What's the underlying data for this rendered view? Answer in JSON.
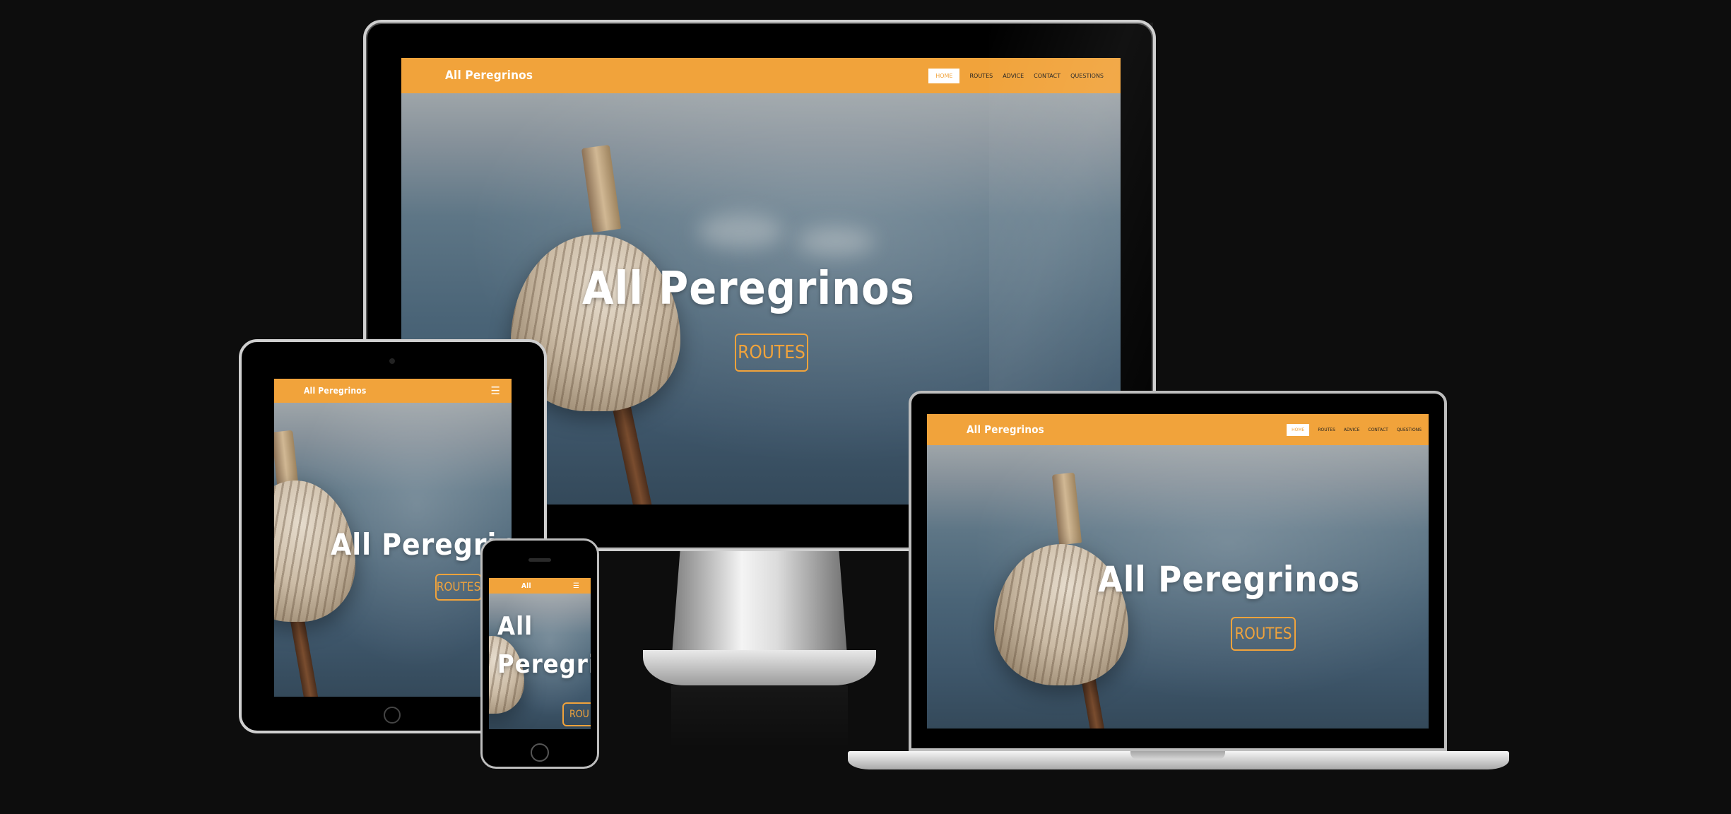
{
  "site": {
    "brand": "All Peregrinos",
    "brand_short": "All",
    "hero_title": "All Peregrinos",
    "hero_title_phone_line1": "All",
    "hero_title_phone_line2": "Peregrin",
    "hero_button": "ROUTES",
    "hero_button_phone": "ROU",
    "nav": [
      "HOME",
      "ROUTES",
      "ADVICE",
      "CONTACT",
      "QUESTIONS"
    ],
    "menu_icon": "☰"
  },
  "colors": {
    "accent": "#f1a33b",
    "background": "#0d0d0d"
  },
  "icons": {
    "menu": "hamburger-menu-icon"
  }
}
